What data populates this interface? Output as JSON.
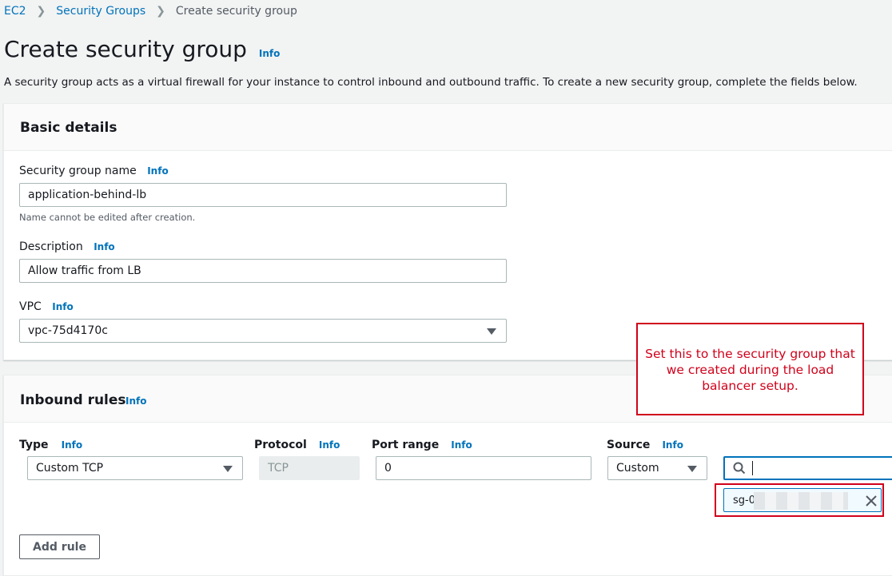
{
  "breadcrumb": {
    "items": [
      "EC2",
      "Security Groups"
    ],
    "current": "Create security group"
  },
  "page": {
    "title": "Create security group",
    "info": "Info",
    "description": "A security group acts as a virtual firewall for your instance to control inbound and outbound traffic. To create a new security group, complete the fields below."
  },
  "basic_details": {
    "title": "Basic details",
    "name_label": "Security group name",
    "name_value": "application-behind-lb",
    "name_hint": "Name cannot be edited after creation.",
    "description_label": "Description",
    "description_value": "Allow traffic from LB",
    "vpc_label": "VPC",
    "vpc_value": "vpc-75d4170c"
  },
  "inbound": {
    "title": "Inbound rules",
    "type_label": "Type",
    "type_value": "Custom TCP",
    "protocol_label": "Protocol",
    "protocol_value": "TCP",
    "port_label": "Port range",
    "port_value": "0",
    "source_label": "Source",
    "source_value": "Custom",
    "search_value": "",
    "token_value": "sg-0",
    "add_rule": "Add rule"
  },
  "annotation": {
    "text": "Set this to the security group that we created during the load balancer setup."
  },
  "colors": {
    "link": "#0073bb",
    "annotation": "#d0021b",
    "panel_header": "#fafafa"
  },
  "icons": [
    "chevron-right-icon",
    "chevron-down-icon",
    "search-icon",
    "close-icon"
  ]
}
